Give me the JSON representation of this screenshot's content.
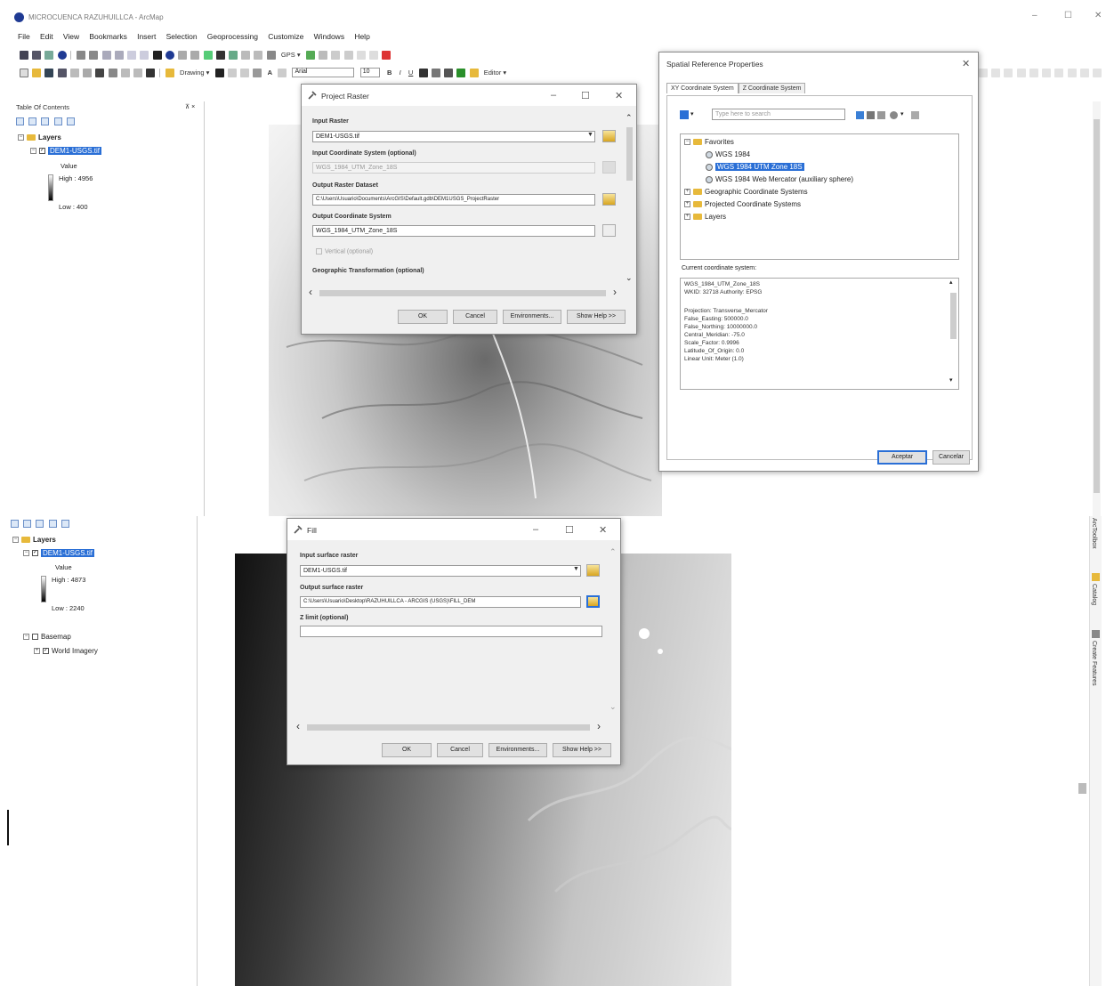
{
  "app": {
    "title": "MICROCUENCA RAZUHUILLCA - ArcMap",
    "menu": [
      "File",
      "Edit",
      "View",
      "Bookmarks",
      "Insert",
      "Selection",
      "Geoprocessing",
      "Customize",
      "Windows",
      "Help"
    ],
    "window_controls": [
      "–",
      "☐",
      "✕"
    ]
  },
  "toolbar": {
    "gps_label": "GPS ▾",
    "drawing_label": "Drawing ▾",
    "font_name": "Arial",
    "font_size": "10",
    "editor_label": "Editor ▾",
    "bold": "B",
    "italic": "I",
    "underline": "U",
    "text_tool": "A"
  },
  "toc_top": {
    "title": "Table Of Contents",
    "pin": "⊼ ×",
    "layers_label": "Layers",
    "layer_name": "DEM1-USGS.tif",
    "value_label": "Value",
    "high_label": "High : 4956",
    "low_label": "Low : 400"
  },
  "project_raster": {
    "title": "Project Raster",
    "input_raster_label": "Input Raster",
    "input_raster_value": "DEM1-USGS.tif",
    "input_cs_label": "Input Coordinate System (optional)",
    "input_cs_value": "WGS_1984_UTM_Zone_18S",
    "output_dataset_label": "Output Raster Dataset",
    "output_dataset_value": "C:\\Users\\Usuario\\Documents\\ArcGIS\\Default.gdb\\DEM1USGS_ProjectRaster",
    "output_cs_label": "Output Coordinate System",
    "output_cs_value": "WGS_1984_UTM_Zone_18S",
    "vertical_label": "Vertical (optional)",
    "geo_transform_label": "Geographic Transformation (optional)",
    "ok": "OK",
    "cancel": "Cancel",
    "environments": "Environments...",
    "show_help": "Show Help >>"
  },
  "spatial_ref": {
    "title": "Spatial Reference Properties",
    "tab_xy": "XY Coordinate System",
    "tab_z": "Z Coordinate System",
    "search_placeholder": "Type here to search",
    "tree": {
      "favorites": "Favorites",
      "wgs84": "WGS 1984",
      "utm18s": "WGS 1984 UTM Zone 18S",
      "web_mercator": "WGS 1984 Web Mercator (auxiliary sphere)",
      "geographic": "Geographic Coordinate Systems",
      "projected": "Projected Coordinate Systems",
      "layers": "Layers"
    },
    "current_label": "Current coordinate system:",
    "current_lines": [
      "WGS_1984_UTM_Zone_18S",
      "WKID: 32718 Authority: EPSG",
      "",
      "Projection: Transverse_Mercator",
      "False_Easting: 500000.0",
      "False_Northing: 10000000.0",
      "Central_Meridian: -75.0",
      "Scale_Factor: 0.9996",
      "Latitude_Of_Origin: 0.0",
      "Linear Unit: Meter (1.0)"
    ],
    "accept": "Aceptar",
    "cancel": "Cancelar"
  },
  "toc_bottom": {
    "layers_label": "Layers",
    "layer_name": "DEM1-USGS.tif",
    "value_label": "Value",
    "high_label": "High : 4873",
    "low_label": "Low : 2240",
    "basemap_label": "Basemap",
    "imagery_label": "World Imagery"
  },
  "fill": {
    "title": "Fill",
    "input_label": "Input surface raster",
    "input_value": "DEM1-USGS.tif",
    "output_label": "Output surface raster",
    "output_value": "C:\\Users\\Usuario\\Desktop\\RAZUHUILLCA - ARCGIS (USGS)\\FILL_DEM",
    "zlimit_label": "Z limit (optional)",
    "zlimit_value": "",
    "ok": "OK",
    "cancel": "Cancel",
    "environments": "Environments...",
    "show_help": "Show Help >>"
  },
  "dock": {
    "toolbox": "ArcToolbox",
    "catalog": "Catalog",
    "create_features": "Create Features"
  },
  "colors": {
    "selection": "#2a6fd6",
    "folder": "#e7b93b"
  }
}
